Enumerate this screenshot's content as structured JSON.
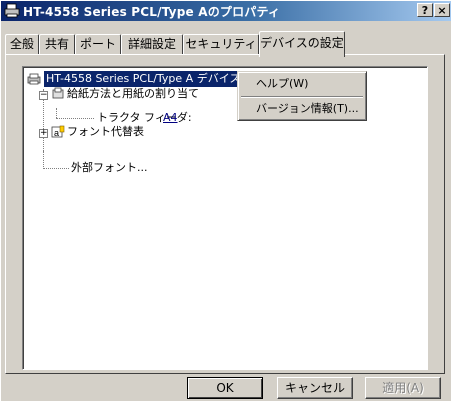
{
  "window": {
    "title": "HT-4558 Series PCL/Type Aのプロパティ",
    "help_btn": "?",
    "close_btn": "×"
  },
  "tabs": [
    {
      "label": "全般"
    },
    {
      "label": "共有"
    },
    {
      "label": "ポート"
    },
    {
      "label": "詳細設定"
    },
    {
      "label": "セキュリティ"
    },
    {
      "label": "デバイスの設定",
      "active": true
    }
  ],
  "tree": {
    "root": "HT-4558 Series PCL/Type A デバイスの設定",
    "paper": "給紙方法と用紙の割り当て",
    "tractor_label": "トラクタ フィーダ:",
    "tractor_value": "A4",
    "font_sub": "フォント代替表",
    "external_font": "外部フォント..."
  },
  "context_menu": {
    "help": "ヘルプ(W)",
    "version": "バージョン情報(T)..."
  },
  "buttons": {
    "ok": "OK",
    "cancel": "キャンセル",
    "apply": "適用(A)"
  }
}
